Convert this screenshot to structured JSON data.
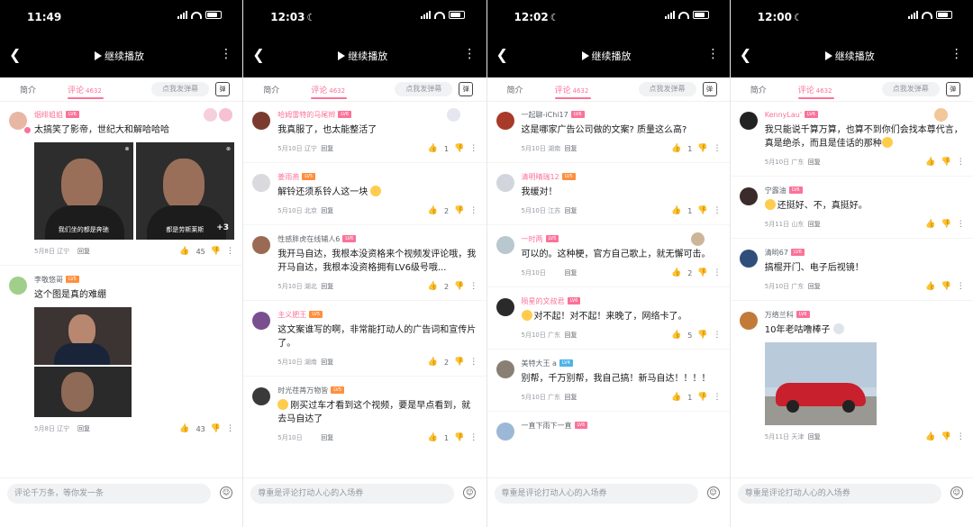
{
  "common": {
    "play_label": "继续播放",
    "tab_intro": "简介",
    "tab_comment": "评论",
    "comment_count": "4632",
    "danmu_placeholder": "点我发弹幕",
    "danmu_icon_text": "弹",
    "reply_label": "回复"
  },
  "panels": [
    {
      "time": "11:49",
      "input_placeholder": "评论千万条，等你发一条",
      "comments": [
        {
          "user": "烟绯姐姐",
          "level": "LV6",
          "text": "太搞笑了影帝，世纪大和解哈哈哈",
          "date": "5月8日",
          "location": "辽宁",
          "likes": "45",
          "images": [
            {
              "caption": "我们坐的都是奔驰"
            },
            {
              "caption": "都是劳斯莱斯",
              "more": "+3"
            }
          ]
        },
        {
          "user": "李敬悠哥",
          "level": "LV5",
          "text": "这个图是真的难绷",
          "date": "5月8日",
          "location": "辽宁",
          "likes": "43"
        }
      ]
    },
    {
      "time": "12:03",
      "input_placeholder": "尊重是评论打动人心的入场券",
      "comments": [
        {
          "user": "哈姆雷特的马尾辫",
          "level": "LV6",
          "text": "我真服了，也太能整活了",
          "date": "5月10日",
          "location": "辽宁",
          "likes": "1"
        },
        {
          "user": "姜雨燕",
          "level": "LV5",
          "text": "解铃还须系铃人这一块",
          "date": "5月10日",
          "location": "北京",
          "likes": "2"
        },
        {
          "user": "性感胖虎在线辅人6",
          "level": "LV6",
          "text": "我开马自达，我根本没资格来个视频发评论哦，我开马自达，我根本没资格拥有LV6级号哦...",
          "date": "5月10日",
          "location": "湖北",
          "likes": "2"
        },
        {
          "user": "主义肥王",
          "level": "LV5",
          "text": "这文案谁写的啊，非常能打动人的广告词和宣传片了。",
          "date": "5月10日",
          "location": "湖南",
          "likes": "2"
        },
        {
          "user": "时光荏苒万物皆",
          "level": "LV5",
          "text": "刚买过车才看到这个视频，要是早点看到，就去马自达了",
          "date": "5月10日",
          "location": "",
          "likes": "1"
        }
      ]
    },
    {
      "time": "12:02",
      "input_placeholder": "尊重是评论打动人心的入场券",
      "comments": [
        {
          "user": "一起聊-iChi17",
          "level": "LV6",
          "text": "这是哪家广告公司做的文案? 质量这么高?",
          "date": "5月10日",
          "location": "湖南",
          "likes": "1"
        },
        {
          "user": "清明晴瑞12",
          "level": "LV5",
          "text": "我缓对！",
          "date": "5月10日",
          "location": "江苏",
          "likes": "1"
        },
        {
          "user": "一时两",
          "level": "LV5",
          "text": "可以的。这种梗，官方自己歌上，就无懈可击。",
          "date": "5月10日",
          "location": "",
          "likes": "2"
        },
        {
          "user": "陨星的文叔君",
          "level": "LV6",
          "text": "对不起！对不起！来晚了，网络卡了。",
          "date": "5月10日",
          "location": "广东",
          "likes": "5"
        },
        {
          "user": "美特大王 a",
          "level": "LV4",
          "text": "别帮，千万别帮，我自己搞！新马自达！！！！",
          "date": "5月10日",
          "location": "广东",
          "likes": "1"
        },
        {
          "user": "一直下雨下一直",
          "level": "LV6",
          "text": "",
          "date": "",
          "location": "",
          "likes": ""
        }
      ]
    },
    {
      "time": "12:00",
      "input_placeholder": "尊重是评论打动人心的入场券",
      "comments": [
        {
          "user": "KennyLau'",
          "level": "LV6",
          "text": "我只能说千算万算，也算不到你们会找本尊代言，真是绝杀，而且是佳话的那种",
          "date": "5月10日",
          "location": "广东",
          "likes": ""
        },
        {
          "user": "宁露油",
          "level": "LV6",
          "text": "还挺好、不，真挺好。",
          "date": "5月11日",
          "location": "山东",
          "likes": ""
        },
        {
          "user": "清哟67",
          "level": "LV6",
          "text": "搞棍开门、电子后视镜！",
          "date": "5月10日",
          "location": "广东",
          "likes": ""
        },
        {
          "user": "万络兰科",
          "level": "LV6",
          "text": "10年老咕噜棒子",
          "date": "5月11日",
          "location": "天津",
          "likes": ""
        }
      ]
    }
  ]
}
